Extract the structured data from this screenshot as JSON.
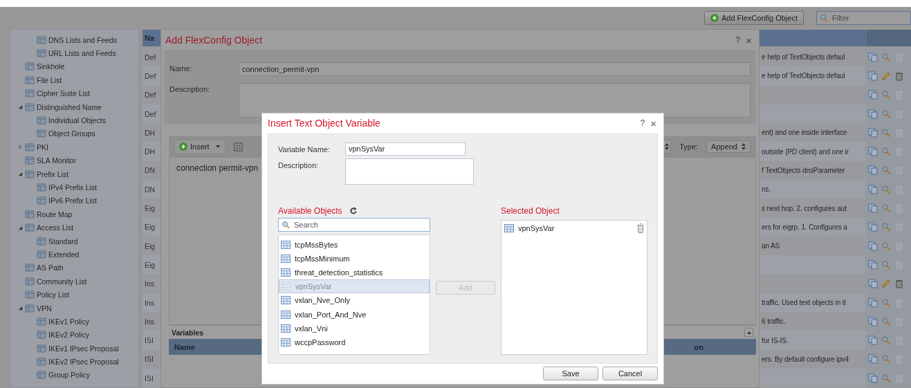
{
  "toolbar": {
    "add_button": "Add FlexConfig Object",
    "filter": {
      "placeholder": "Filter"
    }
  },
  "sidebar": {
    "continued_children": [
      {
        "label": "DNS Lists and Feeds"
      },
      {
        "label": "URL Lists and Feeds"
      }
    ],
    "items": [
      {
        "label": "Sinkhole"
      },
      {
        "label": "File List"
      },
      {
        "label": "Cipher Suite List"
      },
      {
        "label": "Distinguished Name",
        "expanded": true,
        "children": [
          {
            "label": "Individual Objects"
          },
          {
            "label": "Object Groups"
          }
        ]
      },
      {
        "label": "PKI",
        "expanded": false
      },
      {
        "label": "SLA Monitor"
      },
      {
        "label": "Prefix List",
        "expanded": true,
        "children": [
          {
            "label": "IPv4 Prefix List"
          },
          {
            "label": "IPv6 Prefix List"
          }
        ]
      },
      {
        "label": "Route Map"
      },
      {
        "label": "Access List",
        "expanded": true,
        "children": [
          {
            "label": "Standard"
          },
          {
            "label": "Extended"
          }
        ]
      },
      {
        "label": "AS Path"
      },
      {
        "label": "Community List"
      },
      {
        "label": "Policy List"
      },
      {
        "label": "VPN",
        "expanded": true,
        "children": [
          {
            "label": "IKEv1 Policy"
          },
          {
            "label": "IKEv2 Policy"
          },
          {
            "label": "IKEv1 IPsec Proposal"
          },
          {
            "label": "IKEv2 IPsec Proposal"
          },
          {
            "label": "Group Policy"
          }
        ]
      }
    ]
  },
  "table": {
    "header": "Na",
    "rows": [
      {
        "column_1": "Def",
        "description": "e help of TextObjects defaul",
        "editable": false
      },
      {
        "column_1": "Def",
        "description": "e help of TextObjects defaul",
        "editable": true
      },
      {
        "column_1": "Def",
        "editable": false
      },
      {
        "column_1": "Def",
        "editable": false
      },
      {
        "column_1": "DH",
        "description": "ent) and one inside interface",
        "editable": false
      },
      {
        "column_1": "DH",
        "description": "outside (PD client) and one ir",
        "editable": false
      },
      {
        "column_1": "DN",
        "description": "f TextObjects dnsParameter",
        "editable": false
      },
      {
        "column_1": "DN",
        "description": "ns.",
        "editable": false
      },
      {
        "column_1": "Eig",
        "description": "s next hop. 2. configures aut",
        "editable": false
      },
      {
        "column_1": "Eig",
        "description": "ers for eigrp. 1. Configures a",
        "editable": false
      },
      {
        "column_1": "Eig",
        "description": "an AS",
        "editable": false
      },
      {
        "column_1": "Eig",
        "editable": false
      },
      {
        "column_1": "Ins",
        "editable": true
      },
      {
        "column_1": "Ins",
        "description": "traffic. Used text objects in tl",
        "editable": false
      },
      {
        "column_1": "Ins",
        "description": "6 traffic.",
        "editable": false
      },
      {
        "column_1": "ISI",
        "description": "for IS-IS.",
        "editable": false
      },
      {
        "column_1": "ISI",
        "description": "ers. By default configure ipv4",
        "editable": false
      },
      {
        "column_1": "ISI",
        "editable": false
      }
    ]
  },
  "flexconfig_dialog": {
    "title": "Add FlexConfig Object",
    "help": "?",
    "close": "×",
    "name_label": "Name:",
    "name_value": "connection_permit-vpn",
    "description_label": "Description:",
    "insert_button": "Insert",
    "type_label": "Type:",
    "type_value": "Append",
    "editor_text": "connection permit-vpn",
    "variables_title": "Variables",
    "variables_columns": [
      "Name",
      "on"
    ]
  },
  "insert_dialog": {
    "title": "Insert Text Object Variable",
    "help": "?",
    "close": "×",
    "variable_name_label": "Variable Name:",
    "variable_name_value": "vpnSysVar",
    "description_label": "Description:",
    "available_title": "Available Objects",
    "search": {
      "placeholder": "Search"
    },
    "available": [
      {
        "label": "tcpMssBytes",
        "selected": false
      },
      {
        "label": "tcpMssMinimum",
        "selected": false
      },
      {
        "label": "threat_detection_statistics",
        "selected": false
      },
      {
        "label": "vpnSysVar",
        "selected": true
      },
      {
        "label": "vxlan_Nve_Only",
        "selected": false
      },
      {
        "label": "vxlan_Port_And_Nve",
        "selected": false
      },
      {
        "label": "vxlan_Vni",
        "selected": false
      },
      {
        "label": "wccpPassword",
        "selected": false
      }
    ],
    "add_button": {
      "label": "Add",
      "disabled": true
    },
    "selected_title": "Selected Object",
    "selected": [
      {
        "label": "vpnSysVar"
      }
    ],
    "save": "Save",
    "cancel": "Cancel"
  }
}
